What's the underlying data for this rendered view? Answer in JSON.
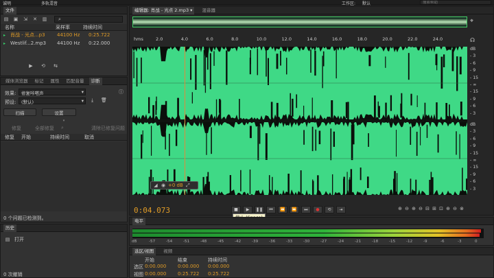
{
  "menubar": {
    "item1": "诚明",
    "item2": "多轨混音",
    "workspace_label": "工作区:",
    "workspace_value": "默认",
    "search_placeholder": "搜索帮助"
  },
  "files_panel": {
    "title": "文件",
    "columns": [
      "名称",
      "采样率",
      "持续时间"
    ],
    "rows": [
      {
        "name": "肖战 - 光点...p3",
        "rate": "44100 Hz",
        "duration": "0:25.722"
      },
      {
        "name": "Westlif...2.mp3",
        "rate": "44100 Hz",
        "duration": "0:22.000"
      }
    ]
  },
  "diagnostics_panel": {
    "tabs": [
      "媒体浏览器",
      "标记",
      "属性",
      "匹配音量",
      "诊断"
    ],
    "effect_label": "效果:",
    "effect_value": "修复咔嗒声",
    "preset_label": "预设:",
    "preset_value": "(默认)",
    "scan_button": "扫描",
    "settings_button": "设置",
    "repair_button": "修复",
    "repair_all_button": "全部修复",
    "clear_button": "清除已修复问题",
    "columns": [
      "修复",
      "开始",
      "持续时间",
      "取消"
    ],
    "status": "0 个问题已检测到。"
  },
  "history_panel": {
    "title": "历史",
    "item": "打开",
    "undo_text": "0 次撤销"
  },
  "editor": {
    "tab_title": "编辑器: 肖战 - 光点 2.mp3",
    "mixer_tab": "混音器",
    "ruler_unit": "hms",
    "ruler_labels": [
      "2.0",
      "4.0",
      "6.0",
      "8.0",
      "10.0",
      "12.0",
      "14.0",
      "16.0",
      "18.0",
      "20.0",
      "22.0",
      "24.0"
    ],
    "db_scale_top": [
      "dB",
      "- 3",
      "- 6",
      "- 9",
      "- 15",
      "- ∞",
      "- 15",
      "- 9",
      "- 6",
      "- 3"
    ],
    "db_scale_bottom": [
      "dB",
      "- 3",
      "- 6",
      "- 9",
      "- 15",
      "- ∞",
      "- 15",
      "- 9",
      "- 6",
      "- 3"
    ],
    "hud_gain": "+0 dB",
    "current_time": "0:04.073",
    "tooltip": "停止 (Space)",
    "waveform_color": "#3fd986",
    "playhead_color": "#e08a3c"
  },
  "levels_panel": {
    "title": "电平",
    "scale": [
      "dB",
      "-57",
      "-54",
      "-51",
      "-48",
      "-45",
      "-42",
      "-39",
      "-36",
      "-33",
      "-30",
      "-27",
      "-24",
      "-21",
      "-18",
      "-15",
      "-12",
      "-9",
      "-6",
      "-3",
      "0"
    ]
  },
  "selection_panel": {
    "tabs": [
      "选区/视图",
      "视频"
    ],
    "columns": [
      "开始",
      "结束",
      "持续时间"
    ],
    "rows": [
      {
        "label": "选区",
        "start": "0:00.000",
        "end": "0:00.000",
        "duration": "0:00.000"
      },
      {
        "label": "视图",
        "start": "0:00.000",
        "end": "0:25.722",
        "duration": "0:25.722"
      }
    ]
  }
}
